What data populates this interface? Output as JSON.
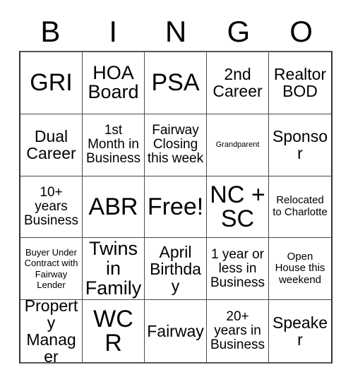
{
  "card": {
    "type": "bingo-card",
    "columns": 5,
    "rows": 5,
    "background_color": "#ffffff",
    "text_color": "#000000",
    "border_color": "#4a4a4a"
  },
  "header": {
    "letters": [
      "B",
      "I",
      "N",
      "G",
      "O"
    ]
  },
  "grid": {
    "rows": [
      {
        "cells": [
          {
            "text": "GRI",
            "size": "fs-xxl"
          },
          {
            "text": "HOA Board",
            "size": "fs-xl"
          },
          {
            "text": "PSA",
            "size": "fs-xxl"
          },
          {
            "text": "2nd Career",
            "size": "fs-lg"
          },
          {
            "text": "Realtor BOD",
            "size": "fs-lg"
          }
        ]
      },
      {
        "cells": [
          {
            "text": "Dual Career",
            "size": "fs-lg"
          },
          {
            "text": "1st Month in Business",
            "size": "fs-md"
          },
          {
            "text": "Fairway Closing this week",
            "size": "fs-md"
          },
          {
            "text": "Grandparent",
            "size": "fs-xxs"
          },
          {
            "text": "Sponsor",
            "size": "fs-lg"
          }
        ]
      },
      {
        "cells": [
          {
            "text": "10+ years Business",
            "size": "fs-md"
          },
          {
            "text": "ABR",
            "size": "fs-xxl"
          },
          {
            "text": "Free!",
            "size": "fs-xxl"
          },
          {
            "text": "NC + SC",
            "size": "fs-xxl"
          },
          {
            "text": "Relocated to Charlotte",
            "size": "fs-sm"
          }
        ]
      },
      {
        "cells": [
          {
            "text": "Buyer Under Contract with Fairway Lender",
            "size": "fs-xs"
          },
          {
            "text": "Twins in Family",
            "size": "fs-xl"
          },
          {
            "text": "April Birthday",
            "size": "fs-lg"
          },
          {
            "text": "1 year or less in Business",
            "size": "fs-md"
          },
          {
            "text": "Open House this weekend",
            "size": "fs-sm"
          }
        ]
      },
      {
        "cells": [
          {
            "text": "Property Manager",
            "size": "fs-lg"
          },
          {
            "text": "WCR",
            "size": "fs-xxl"
          },
          {
            "text": "Fairway",
            "size": "fs-lg"
          },
          {
            "text": "20+ years in Business",
            "size": "fs-md"
          },
          {
            "text": "Speaker",
            "size": "fs-lg"
          }
        ]
      }
    ]
  }
}
